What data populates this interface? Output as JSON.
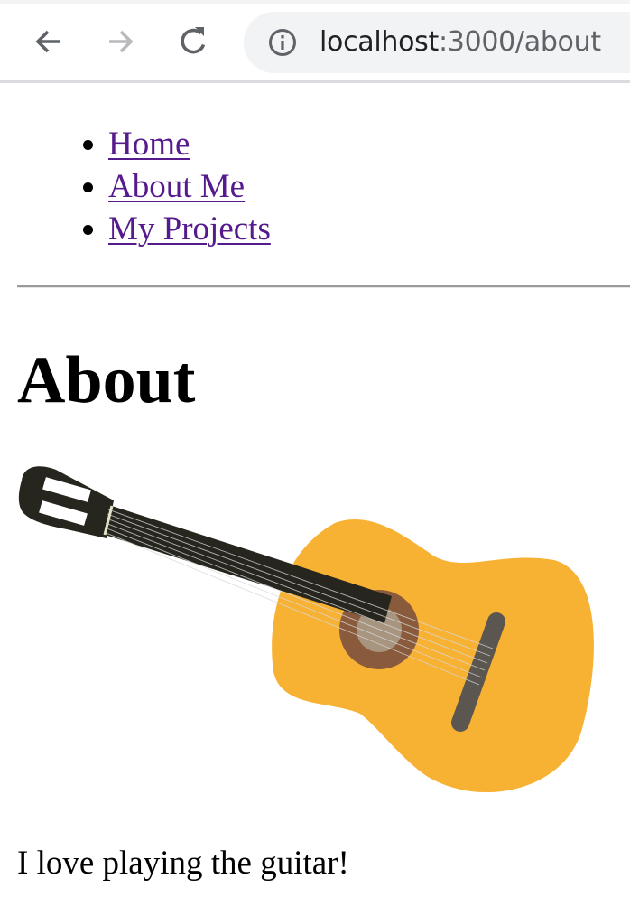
{
  "browser": {
    "url_host": "localhost",
    "url_path": ":3000/about",
    "icons": {
      "back": "arrow-left-icon",
      "forward": "arrow-right-icon",
      "reload": "reload-icon",
      "site_info": "info-icon"
    }
  },
  "nav": {
    "links": [
      {
        "label": "Home"
      },
      {
        "label": "About Me"
      },
      {
        "label": "My Projects"
      }
    ]
  },
  "page": {
    "title": "About",
    "text": "I love playing the guitar!",
    "image": "guitar-illustration"
  },
  "colors": {
    "link": "#551a8b",
    "guitar_body": "#f7b133",
    "guitar_neck": "#26261f",
    "sound_hole": "#8a5a3c"
  }
}
